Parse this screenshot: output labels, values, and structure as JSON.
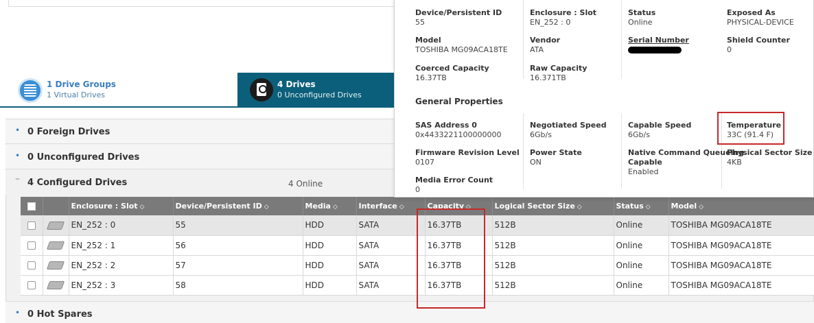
{
  "tabs": {
    "drive_groups": {
      "title": "1 Drive Groups",
      "subtitle": "1 Virtual Drives"
    },
    "drives": {
      "title": "4 Drives",
      "subtitle": "0 Unconfigured Drives"
    }
  },
  "sections": [
    {
      "label": "0 Foreign Drives"
    },
    {
      "label": "0 Unconfigured Drives"
    },
    {
      "label": "4 Configured Drives",
      "extra": "4 Online"
    },
    {
      "label": "0 Hot Spares"
    }
  ],
  "table": {
    "headers": [
      "Enclosure : Slot",
      "Device/Persistent ID",
      "Media",
      "Interface",
      "Capacity",
      "Logical Sector Size",
      "Status",
      "Model"
    ],
    "rows": [
      [
        "EN_252 : 0",
        "55",
        "HDD",
        "SATA",
        "16.37TB",
        "512B",
        "Online",
        "TOSHIBA MG09ACA18TE"
      ],
      [
        "EN_252 : 1",
        "56",
        "HDD",
        "SATA",
        "16.37TB",
        "512B",
        "Online",
        "TOSHIBA MG09ACA18TE"
      ],
      [
        "EN_252 : 2",
        "57",
        "HDD",
        "SATA",
        "16.37TB",
        "512B",
        "Online",
        "TOSHIBA MG09ACA18TE"
      ],
      [
        "EN_252 : 3",
        "58",
        "HDD",
        "SATA",
        "16.37TB",
        "512B",
        "Online",
        "TOSHIBA MG09ACA18TE"
      ]
    ]
  },
  "details": {
    "device_id": {
      "label": "Device/Persistent ID",
      "value": "55"
    },
    "enclosure_slot": {
      "label": "Enclosure : Slot",
      "value": "EN_252 : 0"
    },
    "status": {
      "label": "Status",
      "value": "Online"
    },
    "exposed_as": {
      "label": "Exposed As",
      "value": "PHYSICAL-DEVICE"
    },
    "model": {
      "label": "Model",
      "value": "TOSHIBA MG09ACA18TE"
    },
    "vendor": {
      "label": "Vendor",
      "value": "ATA"
    },
    "serial": {
      "label": "Serial Number"
    },
    "shield_counter": {
      "label": "Shield Counter",
      "value": "0"
    },
    "coerced_capacity": {
      "label": "Coerced Capacity",
      "value": "16.37TB"
    },
    "raw_capacity": {
      "label": "Raw Capacity",
      "value": "16.371TB"
    },
    "general_title": "General Properties",
    "sas_address": {
      "label": "SAS Address 0",
      "value": "0x4433221100000000"
    },
    "negotiated_speed": {
      "label": "Negotiated Speed",
      "value": "6Gb/s"
    },
    "capable_speed": {
      "label": "Capable Speed",
      "value": "6Gb/s"
    },
    "temperature": {
      "label": "Temperature",
      "value": "33C (91.4 F)"
    },
    "firmware": {
      "label": "Firmware Revision Level",
      "value": "0107"
    },
    "power_state": {
      "label": "Power State",
      "value": "ON"
    },
    "ncq": {
      "label1": "Native Command Queueing",
      "label2": "Capable",
      "value": "Enabled"
    },
    "physical_sector": {
      "label": "Physical Sector Size",
      "value": "4KB"
    },
    "media_error": {
      "label": "Media Error Count",
      "value": "0"
    }
  },
  "colors": {
    "accent_tab": "#0c5f7a",
    "highlight_box": "#c62828",
    "header_bg": "#7a7a7a"
  }
}
